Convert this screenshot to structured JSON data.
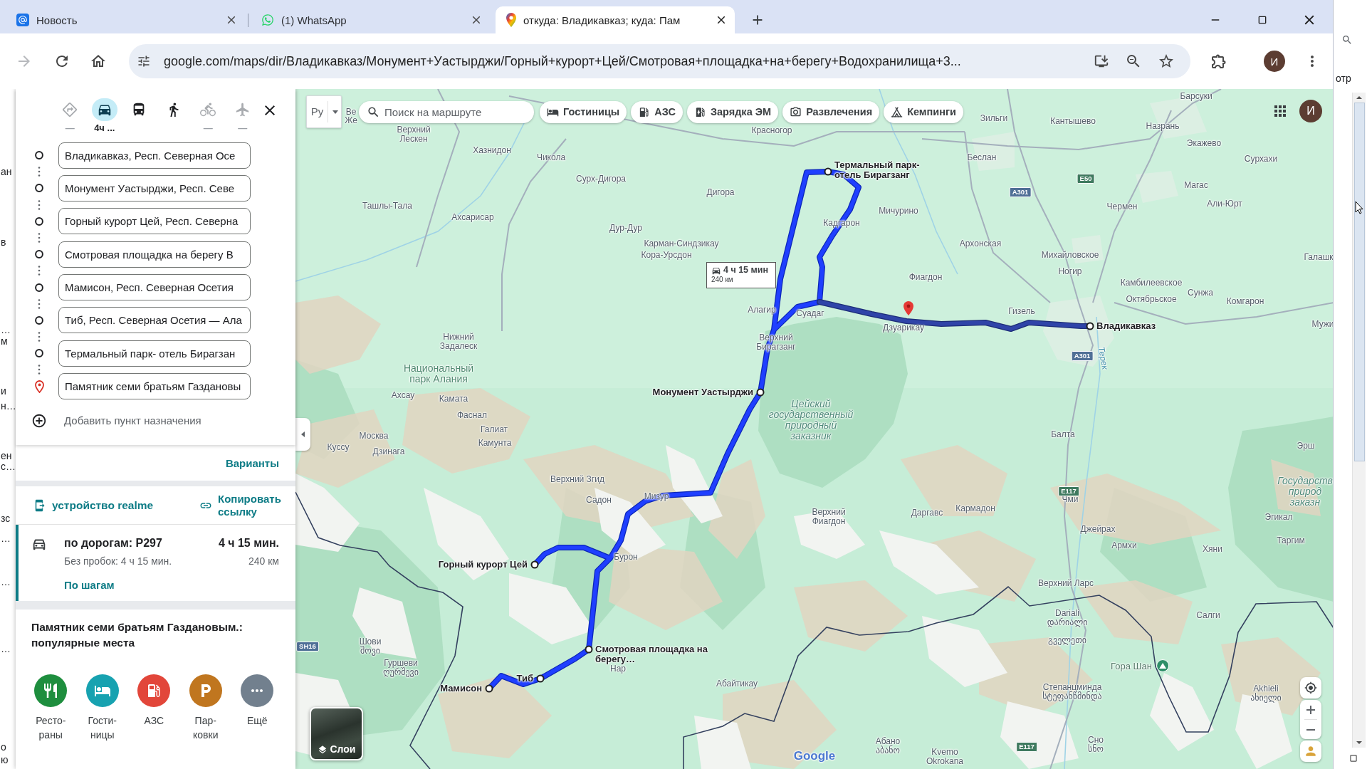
{
  "browser": {
    "tabs": [
      {
        "kind": "mail",
        "title": "Новость",
        "selected": false
      },
      {
        "kind": "chat",
        "title": "(1) WhatsApp",
        "selected": false
      },
      {
        "kind": "maps",
        "title": "откуда: Владикавказ; куда: Пам",
        "selected": true
      }
    ],
    "forward_disabled": true,
    "address": "google.com/maps/dir/Владикавказ/Монумент+Уастырджи/Горный+курорт+Цей/Смотровая+площадка+на+берегу+Водохранилища+3...",
    "profile_initial": "И"
  },
  "directions": {
    "modes": [
      {
        "kind": "best",
        "selected": false,
        "disabled": true,
        "duration": "—"
      },
      {
        "kind": "car",
        "selected": true,
        "disabled": false,
        "duration": "4ч ..."
      },
      {
        "kind": "transit",
        "selected": false,
        "disabled": false
      },
      {
        "kind": "walk",
        "selected": false,
        "disabled": false
      },
      {
        "kind": "bike",
        "selected": false,
        "disabled": true,
        "duration": "—"
      },
      {
        "kind": "flight",
        "selected": false,
        "disabled": true,
        "duration": "—"
      }
    ],
    "waypoints": [
      {
        "kind": "stop",
        "value": "Владикавказ, Респ. Северная Осе"
      },
      {
        "kind": "stop",
        "value": "Монумент Уастырджи, Респ. Севе"
      },
      {
        "kind": "stop",
        "value": "Горный курорт Цей, Респ. Северна"
      },
      {
        "kind": "stop",
        "value": "Смотровая площадка на берегу В"
      },
      {
        "kind": "stop",
        "value": "Мамисон, Респ. Северная Осетия"
      },
      {
        "kind": "stop",
        "value": "Тиб, Респ. Северная Осетия — Ала"
      },
      {
        "kind": "stop",
        "value": "Термальный парк- отель Бирагзан"
      },
      {
        "kind": "destination",
        "value": "Памятник семи братьям Газдановы"
      }
    ],
    "add_destination": "Добавить пункт назначения",
    "options_link": "Варианты",
    "send_to_device": "устройство realme",
    "copy_link": "Копировать ссылку",
    "route": {
      "selected": true,
      "via": "по дорогам: Р297",
      "duration": "4 ч 15 мин.",
      "typical": "Без пробок: 4 ч 15 мин.",
      "distance": "240 км",
      "steps_link": "По шагам"
    }
  },
  "popular": {
    "title": "Памятник семи братьям Газдановым.: популярные места",
    "categories": [
      {
        "kind": "restaurant",
        "label": "Ресто-раны",
        "color": "#1e8e3e"
      },
      {
        "kind": "hotel",
        "label": "Гости-ницы",
        "color": "#17a2b0"
      },
      {
        "kind": "fuel",
        "label": "АЗС",
        "color": "#e2463a"
      },
      {
        "kind": "parking",
        "label": "Пар-ковки",
        "color": "#c0761f"
      },
      {
        "kind": "more",
        "label": "Ещё",
        "color": "#72808e"
      }
    ]
  },
  "map": {
    "language": "Ру",
    "search_placeholder": "Поиск на маршруте",
    "chips": [
      {
        "kind": "hotel",
        "label": "Гостиницы"
      },
      {
        "kind": "fuel",
        "label": "АЗС"
      },
      {
        "kind": "charging",
        "label": "Зарядка ЭМ"
      },
      {
        "kind": "entertainment",
        "label": "Развлечения"
      },
      {
        "kind": "camping",
        "label": "Кемпинги"
      }
    ],
    "callout": {
      "duration": "4 ч 15 мин",
      "distance": "240 км"
    },
    "stops": [
      {
        "label": "Владикавказ"
      },
      {
        "label": "Монумент Уастырджи"
      },
      {
        "label": "Горный курорт Цей"
      },
      {
        "label": "Смотровая площадка на\nберегу…"
      },
      {
        "label": "Мамисон"
      },
      {
        "label": "Тиб"
      },
      {
        "label": "Термальный парк-\nотель Бирагзанг"
      }
    ],
    "places": [
      {
        "name": "Барсуки"
      },
      {
        "name": "Ве"
      },
      {
        "name": "Же"
      },
      {
        "name": "Зильги"
      },
      {
        "name": "Кантышево"
      },
      {
        "name": "Верхний\nЛескен"
      },
      {
        "name": "Красногор"
      },
      {
        "name": "Назрань"
      },
      {
        "name": "Экажево"
      },
      {
        "name": "Хазнидон"
      },
      {
        "name": "Чикола"
      },
      {
        "name": "Беслан"
      },
      {
        "name": "Сурхахи"
      },
      {
        "name": "Сурх-Дигора"
      },
      {
        "name": "Дигора"
      },
      {
        "name": "Магас"
      },
      {
        "name": "Ташлы-Тала"
      },
      {
        "name": "Ахсарисар"
      },
      {
        "name": "Мичурино"
      },
      {
        "name": "Чермен"
      },
      {
        "name": "Али-Юрт"
      },
      {
        "name": "Дур-Дур"
      },
      {
        "name": "Кадгарон"
      },
      {
        "name": "Карман-Синдзикау"
      },
      {
        "name": "Архонская"
      },
      {
        "name": "Кора-Урсдон"
      },
      {
        "name": "Михайловское"
      },
      {
        "name": "Галашк"
      },
      {
        "name": "Фиагдон"
      },
      {
        "name": "Ногир"
      },
      {
        "name": "Камбилеевское"
      },
      {
        "name": "Октябрьское"
      },
      {
        "name": "Сунжа"
      },
      {
        "name": "Комгарон"
      },
      {
        "name": "Алагир"
      },
      {
        "name": "Суадаг"
      },
      {
        "name": "Гизель"
      },
      {
        "name": "Дзуарикау"
      },
      {
        "name": "Мужи"
      },
      {
        "name": "Нижний\nЗадалеск"
      },
      {
        "name": "Верхний\nБирагзанг"
      },
      {
        "name": "Ахсау"
      },
      {
        "name": "Камата"
      },
      {
        "name": "Фаснал"
      },
      {
        "name": "Москва"
      },
      {
        "name": "Галиат"
      },
      {
        "name": "Балта"
      },
      {
        "name": "Куссу"
      },
      {
        "name": "Дзинага"
      },
      {
        "name": "Камунта"
      },
      {
        "name": "Эрш"
      },
      {
        "name": "Верхний Згид"
      },
      {
        "name": "Садон"
      },
      {
        "name": "Мизур"
      },
      {
        "name": "Чми"
      },
      {
        "name": "Верхний\nФиагдон"
      },
      {
        "name": "Даргавс"
      },
      {
        "name": "Кармадон"
      },
      {
        "name": "Эгикал"
      },
      {
        "name": "Джейрах"
      },
      {
        "name": "Бурон"
      },
      {
        "name": "Армхи"
      },
      {
        "name": "Хяни"
      },
      {
        "name": "Таргим"
      },
      {
        "name": "Верхний Ларс"
      },
      {
        "name": "Dariali\nდარიალი"
      },
      {
        "name": "Салги"
      },
      {
        "name": "Шови\nშოვი"
      },
      {
        "name": "გველეთი"
      },
      {
        "name": "Гуршеви\nღურშევი"
      },
      {
        "name": "Нар"
      },
      {
        "name": "Абайтикау"
      },
      {
        "name": "Степанцминда\nსტეფანწმინდა"
      },
      {
        "name": "Akhieli\nახიელი"
      },
      {
        "name": "Абано\nაბანო"
      },
      {
        "name": "Kvemo\nOkrokana"
      },
      {
        "name": "Сно\nსნო"
      }
    ],
    "protected_areas": [
      {
        "kind": "park",
        "name": "Национальный\nпарк Алания"
      },
      {
        "kind": "reserve",
        "name": "Цейский\nгосударственный\nприродный\nзаказник"
      },
      {
        "kind": "reserve",
        "name": "Государств\nприрод\nзаказн"
      }
    ],
    "rivers": [
      {
        "name": "Терек"
      }
    ],
    "peaks": [
      {
        "name": "Гора Шан"
      }
    ],
    "road_shields": [
      {
        "kind": "european",
        "label": "E50"
      },
      {
        "kind": "national",
        "label": "A301"
      },
      {
        "kind": "national",
        "label": "A301"
      },
      {
        "kind": "european",
        "label": "E117"
      },
      {
        "kind": "national",
        "label": "SH16"
      },
      {
        "kind": "european",
        "label": "E117"
      }
    ],
    "layers_label": "Слои",
    "account_initial": "И",
    "logo": "Google"
  },
  "background": {
    "sidebar_fragments": [
      "ан",
      "в",
      "…",
      "м",
      "и",
      "н…",
      "ен",
      "с…",
      "зс",
      "…",
      "…",
      "…",
      "о",
      "ю"
    ],
    "side_window_text": "отр"
  }
}
